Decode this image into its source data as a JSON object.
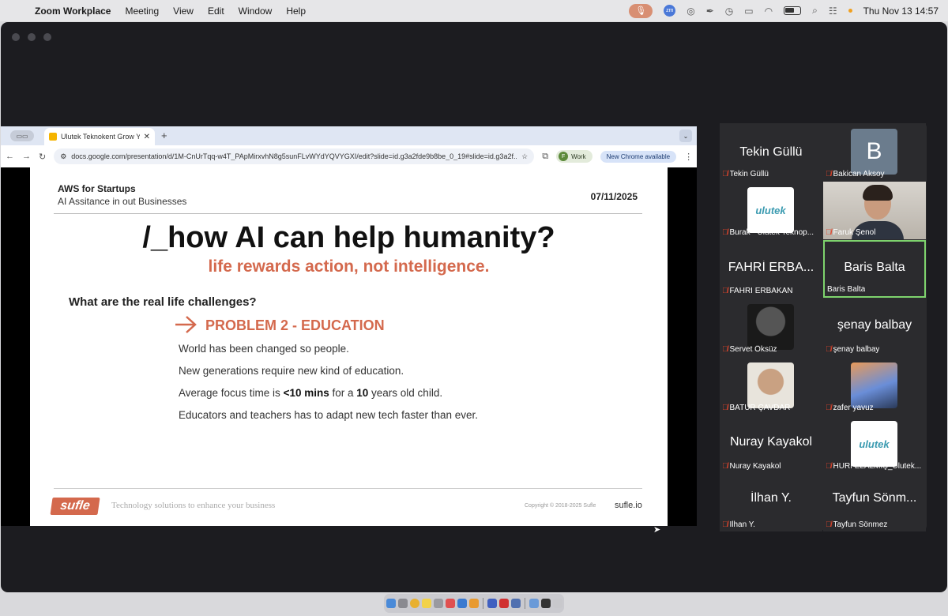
{
  "menubar": {
    "app_name": "Zoom Workplace",
    "menus": [
      "Meeting",
      "View",
      "Edit",
      "Window",
      "Help"
    ],
    "clock": "Thu Nov 13  14:57",
    "zoom_icon_label": "zm"
  },
  "browser": {
    "tab_title": "Ulutek Teknokent Grow Your",
    "url": "docs.google.com/presentation/d/1M-CnUrTqq-w4T_PApMirxvhN8g5sunFLvWYdYQVYGXI/edit?slide=id.g3a2fde9b8be_0_19#slide=id.g3a2f...",
    "profile_label": "Work",
    "profile_initial": "F",
    "update_label": "New Chrome available"
  },
  "slide": {
    "header_title": "AWS for Startups",
    "header_subtitle": "AI Assitance in out Businesses",
    "date": "07/11/2025",
    "headline": "/_how AI can help humanity?",
    "subheadline": "life rewards action, not intelligence.",
    "question": "What are the real life challenges?",
    "problem": "PROBLEM 2 - EDUCATION",
    "bullet1": "World has been changed so people.",
    "bullet2": "New generations require new kind of education.",
    "bullet3_pre": "Average focus time is ",
    "bullet3_b1": "<10 mins",
    "bullet3_mid": " for a ",
    "bullet3_b2": "10",
    "bullet3_post": " years old child.",
    "bullet4": "Educators and teachers has to adapt new tech faster than ever.",
    "logo": "sufle",
    "tagline": "Technology solutions to enhance your business",
    "copyright": "Copyright © 2018-2025 Sufle",
    "site": "sufle.io"
  },
  "participants": [
    {
      "big": "Tekin Güllü",
      "name": "Tekin Güllü"
    },
    {
      "avatar_letter": "B",
      "name": "Bakican Aksoy"
    },
    {
      "avatar_text": "ulutek",
      "name": "Burak - Ulutek Teknop..."
    },
    {
      "name": "Faruk Şenol"
    },
    {
      "big": "FAHRİ ERBA...",
      "name": "FAHRİ ERBAKAN"
    },
    {
      "big": "Baris Balta",
      "name": "Baris Balta"
    },
    {
      "name": "Servet Öksüz"
    },
    {
      "big": "şenay balbay",
      "name": "şenay balbay"
    },
    {
      "name": "BATUR ÇAVDAR"
    },
    {
      "name": "zafer yavuz"
    },
    {
      "big": "Nuray Kayakol",
      "name": "Nuray Kayakol"
    },
    {
      "avatar_text": "ulutek",
      "name": "HURİ ELALMIŞ_Ulutek..."
    },
    {
      "big": "İlhan Y.",
      "name": "İlhan Y."
    },
    {
      "big": "Tayfun Sönm...",
      "name": "Tayfun Sönmez"
    }
  ],
  "colors": {
    "accent": "#d4694d",
    "active_speaker": "#7ed36d",
    "muted": "#e0442b"
  }
}
